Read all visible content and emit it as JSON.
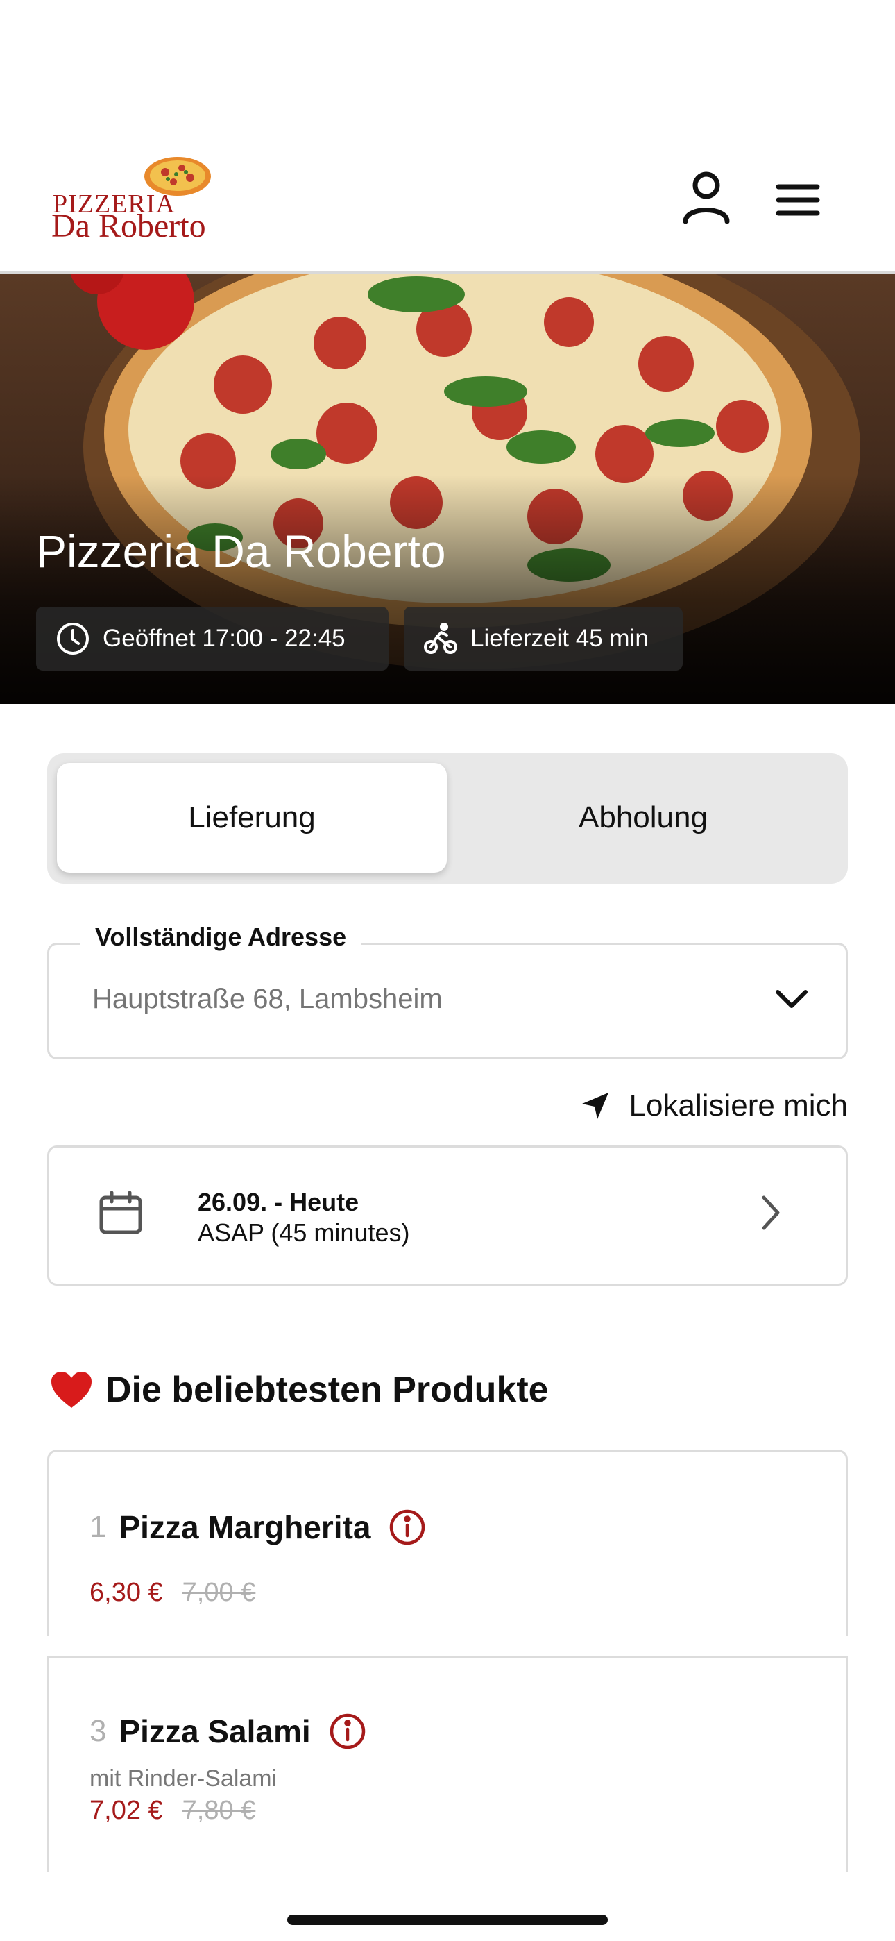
{
  "header": {
    "logo_line1": "PIZZERIA",
    "logo_line2": "Da Roberto",
    "icons": {
      "account": "user-icon",
      "menu": "hamburger-menu-icon"
    }
  },
  "hero": {
    "title": "Pizzeria Da Roberto",
    "opening_hours": "Geöffnet 17:00 - 22:45",
    "delivery_time": "Lieferzeit 45 min",
    "icons": {
      "hours": "clock-icon",
      "delivery": "bicycle-icon"
    }
  },
  "order_mode": {
    "options": [
      "Lieferung",
      "Abholung"
    ],
    "selected": "Lieferung"
  },
  "address": {
    "label": "Vollständige Adresse",
    "placeholder": "Hauptstraße 68, Lambsheim",
    "locate_label": "Lokalisiere mich"
  },
  "schedule": {
    "date": "26.09. - Heute",
    "time": "ASAP (45 minutes)"
  },
  "popular": {
    "title": "Die beliebtesten Produkte",
    "products": [
      {
        "rank": "1",
        "name": "Pizza Margherita",
        "description": "",
        "price": "6,30 €",
        "old_price": "7,00 €"
      },
      {
        "rank": "3",
        "name": "Pizza Salami",
        "description": "mit Rinder-Salami",
        "price": "7,02 €",
        "old_price": "7,80 €"
      }
    ]
  },
  "colors": {
    "accent": "#a51a1a",
    "border": "#dcdcdc",
    "toggle_bg": "#e8e8e8"
  }
}
